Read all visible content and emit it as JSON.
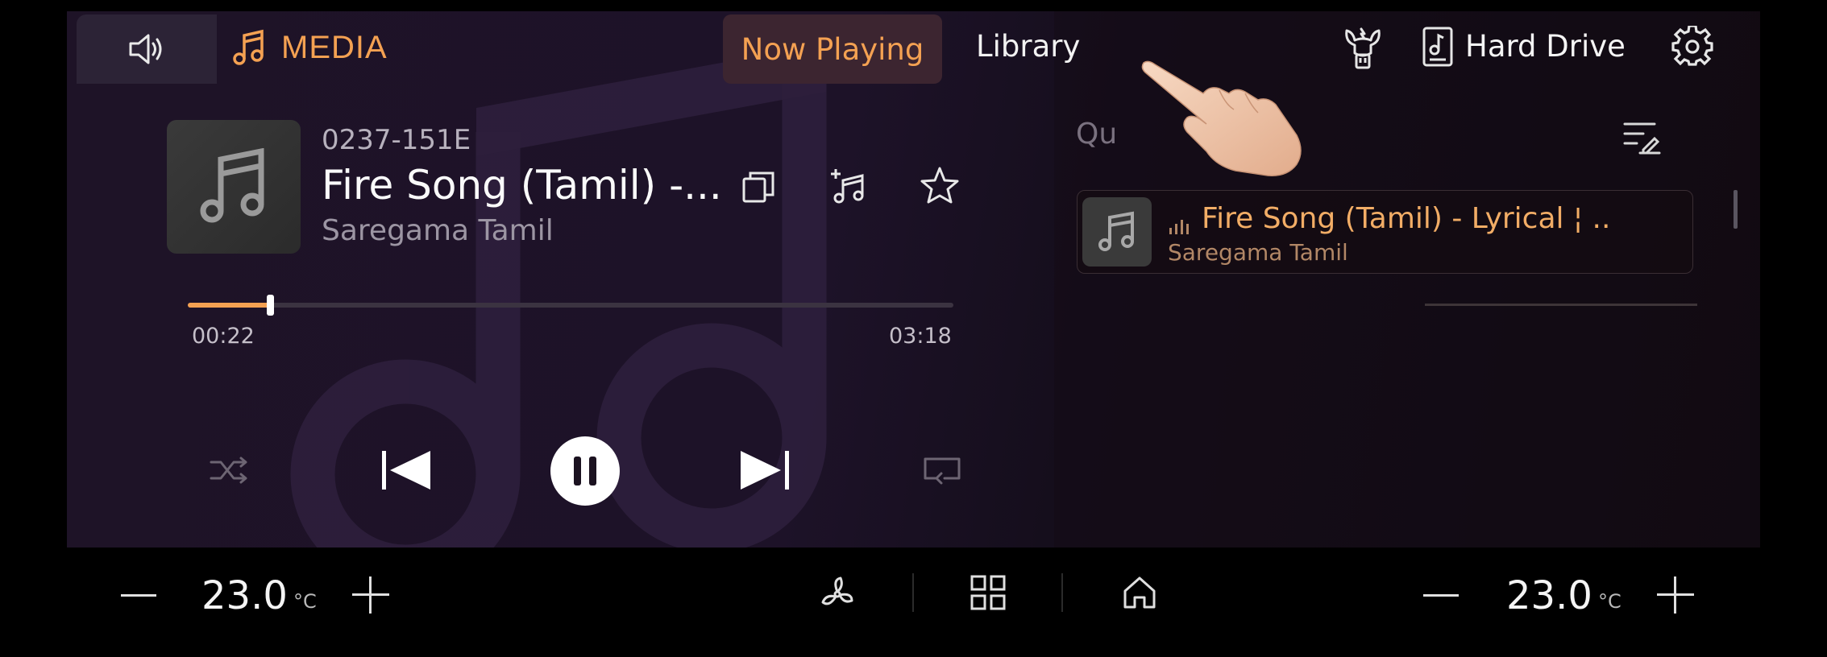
{
  "header": {
    "media_label": "MEDIA",
    "tabs": [
      {
        "label": "Now Playing",
        "active": true
      },
      {
        "label": "Library",
        "active": false
      }
    ],
    "source_label": "Hard Drive",
    "icons": [
      "volume-icon",
      "music-note-icon",
      "usb-icon",
      "hard-drive-icon",
      "settings-icon"
    ]
  },
  "now_playing": {
    "code": "0237-151E",
    "title": "Fire Song (Tamil) -...",
    "artist": "Saregama Tamil",
    "elapsed": "00:22",
    "duration": "03:18",
    "progress": 0.107,
    "actions": [
      "copy-icon",
      "add-to-playlist-icon",
      "favorite-star-icon"
    ]
  },
  "controls": [
    "shuffle-icon",
    "previous-icon",
    "pause-icon",
    "next-icon",
    "repeat-icon"
  ],
  "queue": {
    "label": "Qu",
    "items": [
      {
        "title": "Fire Song (Tamil) - Lyrical ¦ ..",
        "artist": "Saregama Tamil",
        "playing": true
      }
    ]
  },
  "climate": {
    "left_temp": "23.0",
    "right_temp": "23.0",
    "unit": "°C"
  },
  "colors": {
    "accent": "#f4a152",
    "background": "#1e1327"
  }
}
